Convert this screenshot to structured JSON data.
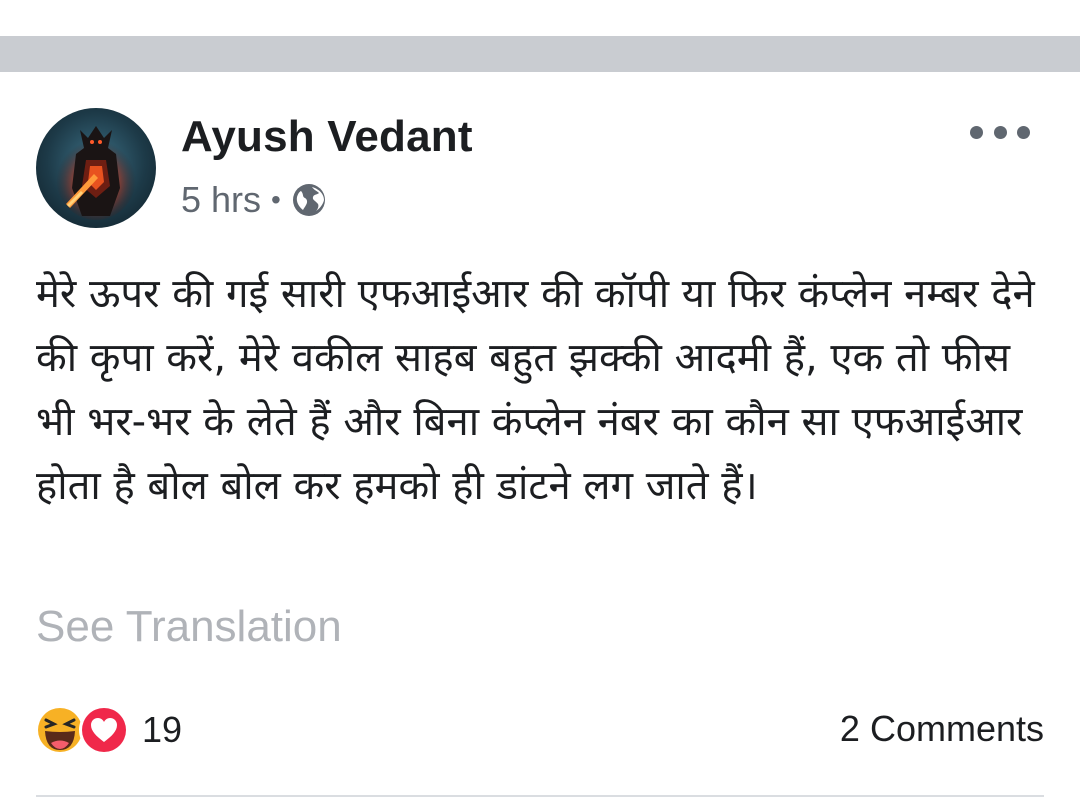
{
  "post": {
    "author": "Ayush Vedant",
    "time": "5 hrs",
    "separator": "•",
    "privacy_icon": "globe-icon",
    "menu_icon": "more-horizontal-icon",
    "text": "मेरे ऊपर की गई सारी एफआईआर की कॉपी या फिर कंप्लेन नम्बर देने की कृपा करें, मेरे वकील साहब बहुत झक्की आदमी हैं, एक तो फीस भी भर-भर के लेते हैं और बिना कंप्लेन नंबर का कौन सा एफआईआर होता है बोल बोल कर हमको ही डांटने लग जाते हैं।",
    "see_translation": "See Translation"
  },
  "footer": {
    "reaction_icons": [
      "haha-reaction-icon",
      "love-reaction-icon"
    ],
    "reaction_count": "19",
    "comments": "2 Comments"
  },
  "colors": {
    "separator_bar": "#c9ccd1",
    "text_primary": "#1c1e21",
    "text_secondary": "#606770",
    "see_translation": "#b0b3b8",
    "love_red": "#f0284a",
    "haha_yellow": "#f7b125"
  }
}
